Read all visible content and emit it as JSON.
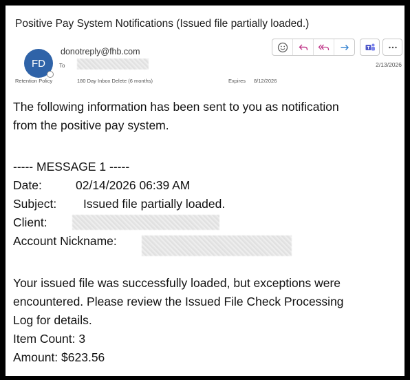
{
  "email": {
    "subject": "Positive Pay System Notifications (Issued file partially loaded.)",
    "avatar_initials": "FD",
    "sender": "donotreply@fhb.com",
    "to_label": "To",
    "retention_policy": "Retention Policy",
    "retention_value": "180 Day Inbox Delete (6 months)",
    "expires_label": "Expires",
    "expires_value": "8/12/2026",
    "date": "2/13/2026"
  },
  "body": {
    "intro_line1": "The following information has been sent to you as notification",
    "intro_line2": "from the positive pay system.",
    "message_header": "----- MESSAGE 1 -----",
    "date_label": "Date:",
    "date_value": "02/14/2026 06:39 AM",
    "subject_label": "Subject:",
    "subject_value": "Issued file partially loaded.",
    "client_label": "Client:",
    "account_label": "Account Nickname:",
    "detail_line1": "Your issued file was successfully loaded, but exceptions were",
    "detail_line2": "encountered.  Please review the Issued File Check Processing",
    "detail_line3": "Log for details.",
    "item_count": "Item Count: 3",
    "amount": "Amount: $623.56"
  },
  "icons": {
    "emoji": "smiley-icon",
    "reply": "reply-icon",
    "reply_all": "reply-all-icon",
    "forward": "forward-icon",
    "teams": "teams-icon",
    "more": "more-icon"
  },
  "colors": {
    "avatar": "#2f63a8",
    "reply_icon": "#c0398a",
    "forward_icon": "#2f7fd0",
    "teams_icon": "#5059c9"
  }
}
